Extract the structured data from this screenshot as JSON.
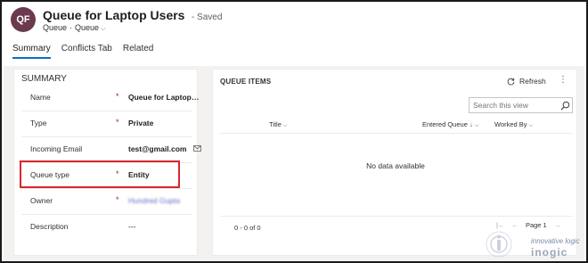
{
  "header": {
    "avatar_initials": "QF",
    "title": "Queue for Laptop Users",
    "saved_status": "- Saved",
    "breadcrumb": {
      "entity": "Queue",
      "form": "Queue"
    }
  },
  "tabs": [
    {
      "label": "Summary",
      "active": true
    },
    {
      "label": "Conflicts Tab",
      "active": false
    },
    {
      "label": "Related",
      "active": false
    }
  ],
  "summary": {
    "title": "SUMMARY",
    "fields": [
      {
        "label": "Name",
        "required": "*",
        "value": "Queue for Laptop Us..."
      },
      {
        "label": "Type",
        "required": "*",
        "value": "Private"
      },
      {
        "label": "Incoming Email",
        "required": "",
        "value": "test@gmail.com",
        "icon": "email-icon"
      },
      {
        "label": "Queue type",
        "required": "*",
        "value": "Entity"
      },
      {
        "label": "Owner",
        "required": "*",
        "value": "Hundred Gupta"
      },
      {
        "label": "Description",
        "required": "",
        "value": "---"
      }
    ]
  },
  "queue_items": {
    "title": "QUEUE ITEMS",
    "refresh_label": "Refresh",
    "search_placeholder": "Search this view",
    "columns": {
      "title": "Title",
      "entered_queue": "Entered Queue",
      "worked_by": "Worked By"
    },
    "empty_message": "No data available",
    "record_count": "0 - 0 of 0",
    "page_label": "Page 1"
  },
  "watermark": {
    "tagline": "innovative logic",
    "brand": "inogic"
  },
  "colors": {
    "accent": "#0f6cbd",
    "required": "#a4262c",
    "highlight": "#d9262c",
    "avatar": "#6b3a4e"
  }
}
